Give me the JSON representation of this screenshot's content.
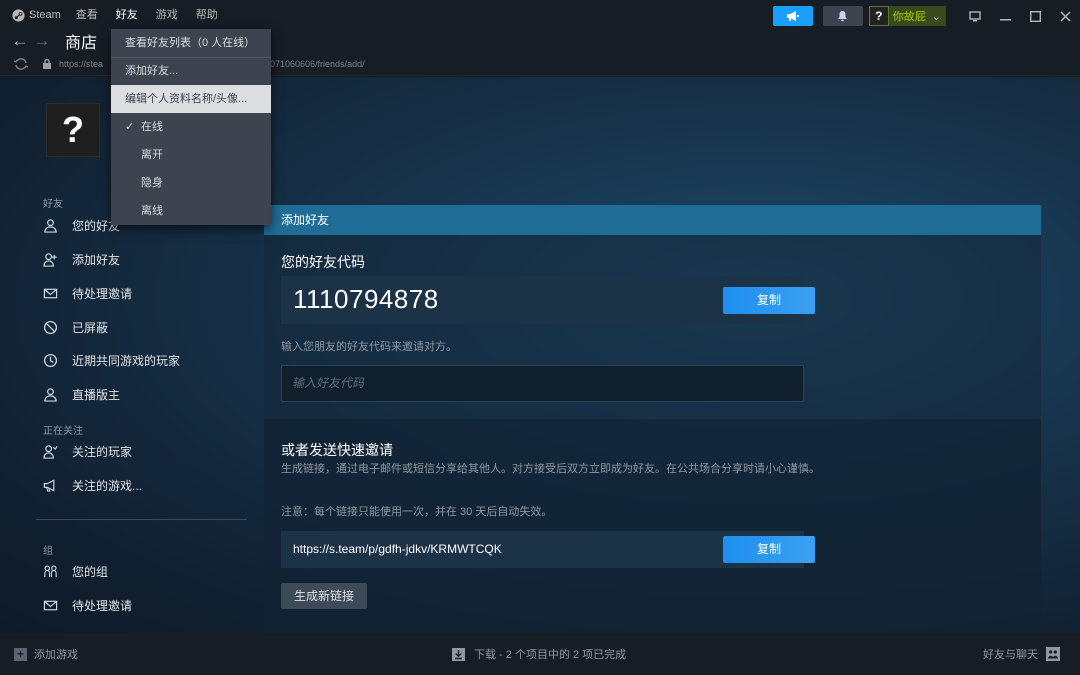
{
  "menubar": {
    "app_name": "Steam",
    "items": [
      "查看",
      "好友",
      "游戏",
      "帮助"
    ],
    "user_avatar_char": "?",
    "user_name": "你故屁",
    "user_name_suffix": "⌄"
  },
  "nav": {
    "title": "商店",
    "back_glyph": "←",
    "forward_glyph": "→"
  },
  "urlbar": {
    "url_prefix": "https://stea",
    "url_suffix": "071060606/friends/add/"
  },
  "dropdown": {
    "items": [
      "查看好友列表（0 人在线）",
      "添加好友...",
      "编辑个人资料名称/头像..."
    ],
    "status_items": [
      "在线",
      "离开",
      "隐身",
      "离线"
    ],
    "checked_status": "✓"
  },
  "profile": {
    "avatar_char": "?"
  },
  "sidebar": {
    "friends_header": "好友",
    "friends_items": [
      "您的好友",
      "添加好友",
      "待处理邀请",
      "已屏蔽",
      "近期共同游戏的玩家",
      "直播版主"
    ],
    "following_header": "正在关注",
    "following_items": [
      "关注的玩家",
      "关注的游戏..."
    ],
    "groups_header": "组",
    "groups_items": [
      "您的组",
      "待处理邀请"
    ]
  },
  "panel": {
    "header": "添加好友",
    "code_title": "您的好友代码",
    "code_value": "1110794878",
    "copy_label": "复制",
    "input_hint": "输入您朋友的好友代码来邀请对方。",
    "input_placeholder": "输入好友代码",
    "quick_title": "或者发送快速邀请",
    "quick_desc": "生成链接，通过电子邮件或短信分享给其他人。对方接受后双方立即成为好友。在公共场合分享时请小心谨慎。",
    "quick_note": "注意：每个链接只能使用一次，并在 30 天后自动失效。",
    "link_value": "https://s.team/p/gdfh-jdkv/KRMWTCQK",
    "generate_label": "生成新链接"
  },
  "bottombar": {
    "add_game": "添加游戏",
    "download_status": "下载 - 2 个项目中的 2 项已完成",
    "friends_chat": "好友与聊天"
  },
  "colors": {
    "accent_blue": "#1a9fff",
    "header_bar": "#1f6c97",
    "user_green": "#a4d007"
  }
}
